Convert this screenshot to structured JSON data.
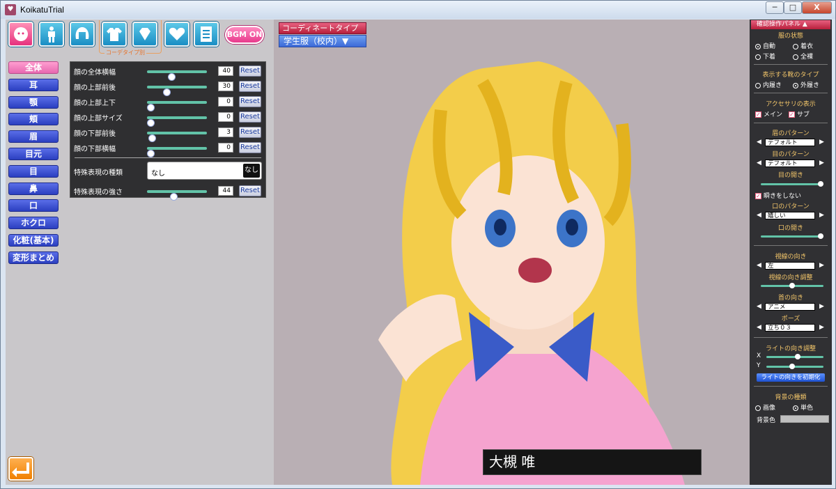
{
  "window": {
    "title": "KoikatuTrial",
    "min_label": "─",
    "max_label": "□",
    "close_label": "X"
  },
  "toolbar": {
    "coord_label": "コーデタイプ別",
    "bgm_label": "BGM ON"
  },
  "categories": [
    "全体",
    "耳",
    "顎",
    "頬",
    "眉",
    "目元",
    "目",
    "鼻",
    "口",
    "ホクロ",
    "化粧(基本)",
    "変形まとめ"
  ],
  "sliders": [
    {
      "label": "顔の全体横幅",
      "value": "40",
      "level": 0.4,
      "reset": "Reset"
    },
    {
      "label": "顔の上部前後",
      "value": "30",
      "level": 0.3,
      "reset": "Reset"
    },
    {
      "label": "顔の上部上下",
      "value": "0",
      "level": 0.0,
      "reset": "Reset"
    },
    {
      "label": "顔の上部サイズ",
      "value": "0",
      "level": 0.0,
      "reset": "Reset"
    },
    {
      "label": "顔の下部前後",
      "value": "3",
      "level": 0.03,
      "reset": "Reset"
    },
    {
      "label": "顔の下部横幅",
      "value": "0",
      "level": 0.0,
      "reset": "Reset"
    }
  ],
  "expression": {
    "type_label": "特殊表現の種類",
    "type_value": "なし",
    "type_button": "なし",
    "strength_label": "特殊表現の強さ",
    "strength_value": "44",
    "strength_level": 0.44,
    "reset": "Reset"
  },
  "coordinate": {
    "type_button": "コーディネートタイプ",
    "type_value": "学生服（校内）▼"
  },
  "character_name": "大槻 唯",
  "right_panel": {
    "header": "確認操作パネル ▲",
    "clothes_state": {
      "title": "服の状態",
      "options": [
        "自動",
        "着衣",
        "下着",
        "全裸"
      ],
      "selected": "自動"
    },
    "shoes_type": {
      "title": "表示する靴のタイプ",
      "options": [
        "内履き",
        "外履き"
      ],
      "selected": "外履き"
    },
    "accessory": {
      "title": "アクセサリの表示",
      "options": [
        "メイン",
        "サブ"
      ]
    },
    "eyebrow_pattern": {
      "title": "眉のパターン",
      "value": "デフォルト"
    },
    "eye_pattern": {
      "title": "目のパターン",
      "value": "デフォルト"
    },
    "eye_open": {
      "title": "目の開き",
      "level": 1.0
    },
    "no_blink": {
      "label": "瞬きをしない"
    },
    "mouth_pattern": {
      "title": "口のパターン",
      "value": "嬉しい"
    },
    "mouth_open": {
      "title": "口の開き",
      "level": 1.0
    },
    "gaze": {
      "title": "視線の向き",
      "value": "左"
    },
    "gaze_adjust": {
      "title": "視線の向き調整",
      "level": 0.5
    },
    "neck": {
      "title": "首の向き",
      "value": "アニメ"
    },
    "pose": {
      "title": "ポーズ",
      "value": "立ち０３"
    },
    "light": {
      "title": "ライトの向き調整",
      "x_label": "X",
      "y_label": "Y",
      "x_level": 0.55,
      "y_level": 0.45,
      "reset_label": "ライトの向きを初期化"
    },
    "background": {
      "title": "背景の種類",
      "options": [
        "画像",
        "単色"
      ],
      "selected": "単色",
      "color_label": "背景色"
    }
  },
  "colors": {
    "accent_pink": "#e768b0",
    "category_blue": "#2b3fc0",
    "slider_green": "#62c3a8",
    "panel_dark": "#303033"
  }
}
